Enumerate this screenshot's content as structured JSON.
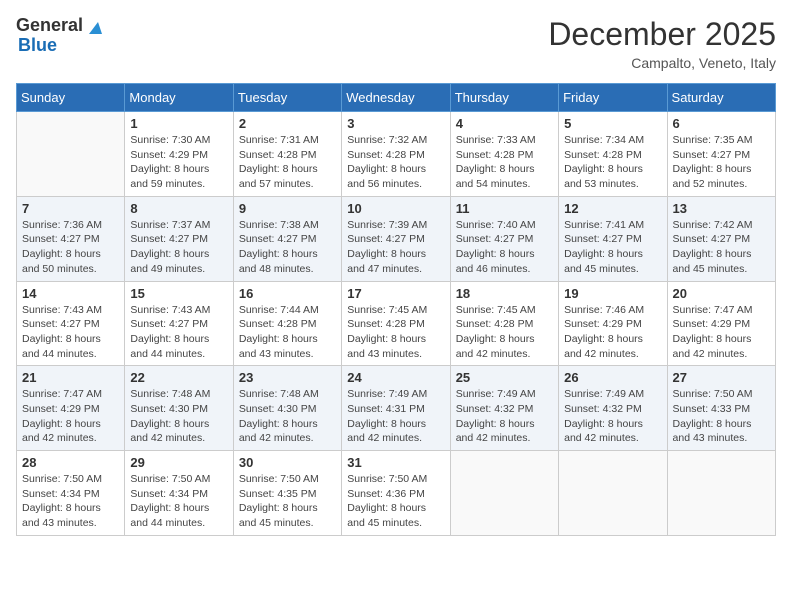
{
  "header": {
    "logo_general": "General",
    "logo_blue": "Blue",
    "month_year": "December 2025",
    "location": "Campalto, Veneto, Italy"
  },
  "calendar": {
    "days_of_week": [
      "Sunday",
      "Monday",
      "Tuesday",
      "Wednesday",
      "Thursday",
      "Friday",
      "Saturday"
    ],
    "weeks": [
      [
        {
          "day": "",
          "info": ""
        },
        {
          "day": "1",
          "info": "Sunrise: 7:30 AM\nSunset: 4:29 PM\nDaylight: 8 hours\nand 59 minutes."
        },
        {
          "day": "2",
          "info": "Sunrise: 7:31 AM\nSunset: 4:28 PM\nDaylight: 8 hours\nand 57 minutes."
        },
        {
          "day": "3",
          "info": "Sunrise: 7:32 AM\nSunset: 4:28 PM\nDaylight: 8 hours\nand 56 minutes."
        },
        {
          "day": "4",
          "info": "Sunrise: 7:33 AM\nSunset: 4:28 PM\nDaylight: 8 hours\nand 54 minutes."
        },
        {
          "day": "5",
          "info": "Sunrise: 7:34 AM\nSunset: 4:28 PM\nDaylight: 8 hours\nand 53 minutes."
        },
        {
          "day": "6",
          "info": "Sunrise: 7:35 AM\nSunset: 4:27 PM\nDaylight: 8 hours\nand 52 minutes."
        }
      ],
      [
        {
          "day": "7",
          "info": "Sunrise: 7:36 AM\nSunset: 4:27 PM\nDaylight: 8 hours\nand 50 minutes."
        },
        {
          "day": "8",
          "info": "Sunrise: 7:37 AM\nSunset: 4:27 PM\nDaylight: 8 hours\nand 49 minutes."
        },
        {
          "day": "9",
          "info": "Sunrise: 7:38 AM\nSunset: 4:27 PM\nDaylight: 8 hours\nand 48 minutes."
        },
        {
          "day": "10",
          "info": "Sunrise: 7:39 AM\nSunset: 4:27 PM\nDaylight: 8 hours\nand 47 minutes."
        },
        {
          "day": "11",
          "info": "Sunrise: 7:40 AM\nSunset: 4:27 PM\nDaylight: 8 hours\nand 46 minutes."
        },
        {
          "day": "12",
          "info": "Sunrise: 7:41 AM\nSunset: 4:27 PM\nDaylight: 8 hours\nand 45 minutes."
        },
        {
          "day": "13",
          "info": "Sunrise: 7:42 AM\nSunset: 4:27 PM\nDaylight: 8 hours\nand 45 minutes."
        }
      ],
      [
        {
          "day": "14",
          "info": "Sunrise: 7:43 AM\nSunset: 4:27 PM\nDaylight: 8 hours\nand 44 minutes."
        },
        {
          "day": "15",
          "info": "Sunrise: 7:43 AM\nSunset: 4:27 PM\nDaylight: 8 hours\nand 44 minutes."
        },
        {
          "day": "16",
          "info": "Sunrise: 7:44 AM\nSunset: 4:28 PM\nDaylight: 8 hours\nand 43 minutes."
        },
        {
          "day": "17",
          "info": "Sunrise: 7:45 AM\nSunset: 4:28 PM\nDaylight: 8 hours\nand 43 minutes."
        },
        {
          "day": "18",
          "info": "Sunrise: 7:45 AM\nSunset: 4:28 PM\nDaylight: 8 hours\nand 42 minutes."
        },
        {
          "day": "19",
          "info": "Sunrise: 7:46 AM\nSunset: 4:29 PM\nDaylight: 8 hours\nand 42 minutes."
        },
        {
          "day": "20",
          "info": "Sunrise: 7:47 AM\nSunset: 4:29 PM\nDaylight: 8 hours\nand 42 minutes."
        }
      ],
      [
        {
          "day": "21",
          "info": "Sunrise: 7:47 AM\nSunset: 4:29 PM\nDaylight: 8 hours\nand 42 minutes."
        },
        {
          "day": "22",
          "info": "Sunrise: 7:48 AM\nSunset: 4:30 PM\nDaylight: 8 hours\nand 42 minutes."
        },
        {
          "day": "23",
          "info": "Sunrise: 7:48 AM\nSunset: 4:30 PM\nDaylight: 8 hours\nand 42 minutes."
        },
        {
          "day": "24",
          "info": "Sunrise: 7:49 AM\nSunset: 4:31 PM\nDaylight: 8 hours\nand 42 minutes."
        },
        {
          "day": "25",
          "info": "Sunrise: 7:49 AM\nSunset: 4:32 PM\nDaylight: 8 hours\nand 42 minutes."
        },
        {
          "day": "26",
          "info": "Sunrise: 7:49 AM\nSunset: 4:32 PM\nDaylight: 8 hours\nand 42 minutes."
        },
        {
          "day": "27",
          "info": "Sunrise: 7:50 AM\nSunset: 4:33 PM\nDaylight: 8 hours\nand 43 minutes."
        }
      ],
      [
        {
          "day": "28",
          "info": "Sunrise: 7:50 AM\nSunset: 4:34 PM\nDaylight: 8 hours\nand 43 minutes."
        },
        {
          "day": "29",
          "info": "Sunrise: 7:50 AM\nSunset: 4:34 PM\nDaylight: 8 hours\nand 44 minutes."
        },
        {
          "day": "30",
          "info": "Sunrise: 7:50 AM\nSunset: 4:35 PM\nDaylight: 8 hours\nand 45 minutes."
        },
        {
          "day": "31",
          "info": "Sunrise: 7:50 AM\nSunset: 4:36 PM\nDaylight: 8 hours\nand 45 minutes."
        },
        {
          "day": "",
          "info": ""
        },
        {
          "day": "",
          "info": ""
        },
        {
          "day": "",
          "info": ""
        }
      ]
    ]
  }
}
